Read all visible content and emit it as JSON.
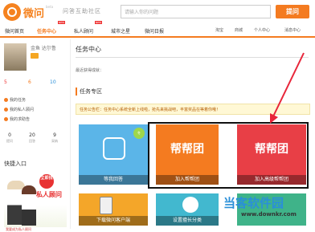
{
  "header": {
    "logo_text": "微问",
    "logo_sup": "beta",
    "slogan": "问答互助社区",
    "search_placeholder": "请输入你的问题",
    "ask_label": "提问"
  },
  "nav": {
    "items": [
      {
        "label": "微问首页"
      },
      {
        "label": "任务中心",
        "active": true
      },
      {
        "label": "私人顾问"
      },
      {
        "label": "城市之星"
      },
      {
        "label": "微问日报"
      }
    ],
    "badge": "NEW",
    "right": [
      "淘宝",
      "商城",
      "个人中心",
      "消息中心"
    ]
  },
  "sidebar": {
    "username": "金鱼 达尔鲁",
    "stats": [
      "5",
      "6",
      "10"
    ],
    "links": [
      "我的任务",
      "我的私人顾问",
      "我的求助告"
    ],
    "counts": [
      {
        "value": "0",
        "label": "提问"
      },
      {
        "value": "20",
        "label": "回答"
      },
      {
        "value": "9",
        "label": "采纳"
      }
    ],
    "quick_title": "快捷入口",
    "banner_circle": "立即找",
    "banner_text": "私人顾问",
    "banner_sub": "我要成为私人顾问"
  },
  "main": {
    "title": "任务中心",
    "latest": "最近获得成就：",
    "section_title": "任务专区",
    "notice": "任务公告栏：任务中心系统全新上线啦，抢先来挑战吧，丰富奖品在等着你哦！",
    "tiles": [
      {
        "label": "等我回答",
        "tag": "冬"
      },
      {
        "label": "加入帮帮团",
        "brand": "帮帮团"
      },
      {
        "label": "加入高级帮帮团",
        "brand": "帮帮团"
      },
      {
        "label": "下载微问客户端"
      },
      {
        "label": "设置擅长分类"
      }
    ]
  },
  "watermark": {
    "text": "当客软件园",
    "url": "www.downkr.com"
  }
}
